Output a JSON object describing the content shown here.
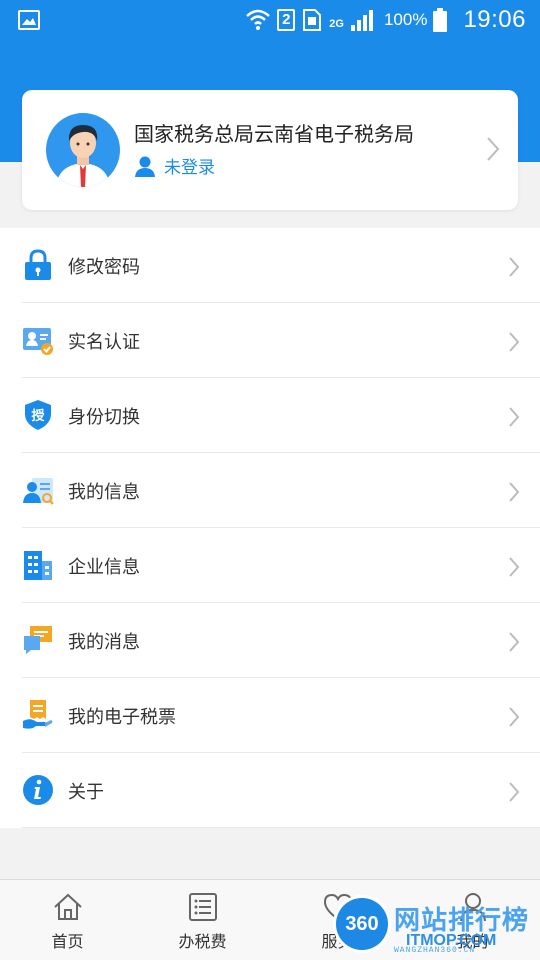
{
  "status_bar": {
    "sim_slot": "2",
    "network": "2G",
    "battery": "100%",
    "time": "19:06"
  },
  "profile": {
    "name": "国家税务总局云南省电子税务局",
    "login_status": "未登录"
  },
  "menu": [
    {
      "label": "修改密码",
      "icon": "lock-icon"
    },
    {
      "label": "实名认证",
      "icon": "id-verify-icon"
    },
    {
      "label": "身份切换",
      "icon": "shield-auth-icon"
    },
    {
      "label": "我的信息",
      "icon": "profile-info-icon"
    },
    {
      "label": "企业信息",
      "icon": "building-icon"
    },
    {
      "label": "我的消息",
      "icon": "message-icon"
    },
    {
      "label": "我的电子税票",
      "icon": "ticket-icon"
    },
    {
      "label": "关于",
      "icon": "info-icon"
    }
  ],
  "tabbar": [
    {
      "label": "首页",
      "icon": "home-icon"
    },
    {
      "label": "办税费",
      "icon": "list-icon"
    },
    {
      "label": "服务",
      "icon": "heart-icon"
    },
    {
      "label": "我的",
      "icon": "user-icon"
    }
  ],
  "watermark": {
    "badge": "360",
    "title": "网站排行榜",
    "site": "ITMOP.COM",
    "url": "WANGZHAN360.CN"
  },
  "colors": {
    "primary": "#1b8bea",
    "background": "#f2f2f2"
  }
}
